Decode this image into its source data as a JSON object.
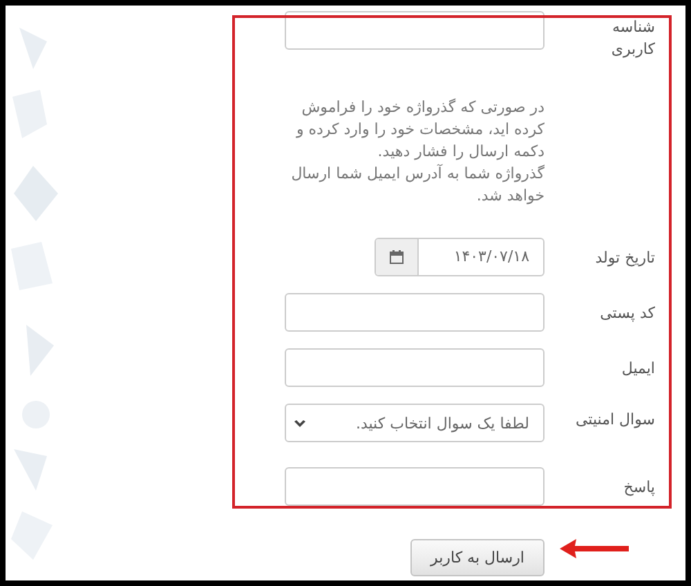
{
  "form": {
    "rows": [
      {
        "kind": "text",
        "label": "شناسه کاربری"
      },
      {
        "kind": "note",
        "paragraphs": [
          "در صورتی که گذرواژه خود را فراموش کرده اید، مشخصات خود را وارد کرده و دکمه ارسال را فشار دهید.",
          "گذرواژه شما به آدرس ایمیل شما ارسال خواهد شد."
        ]
      },
      {
        "kind": "date",
        "label": "تاریخ تولد",
        "value": "۱۴۰۳/۰۷/۱۸"
      },
      {
        "kind": "text",
        "label": "کد پستی"
      },
      {
        "kind": "text",
        "label": "ایمیل"
      },
      {
        "kind": "select",
        "label": "سوال امنیتی",
        "placeholder": "لطفا یک سوال انتخاب کنید."
      },
      {
        "kind": "text",
        "label": "پاسخ"
      }
    ],
    "submit": "ارسال به کاربر"
  }
}
